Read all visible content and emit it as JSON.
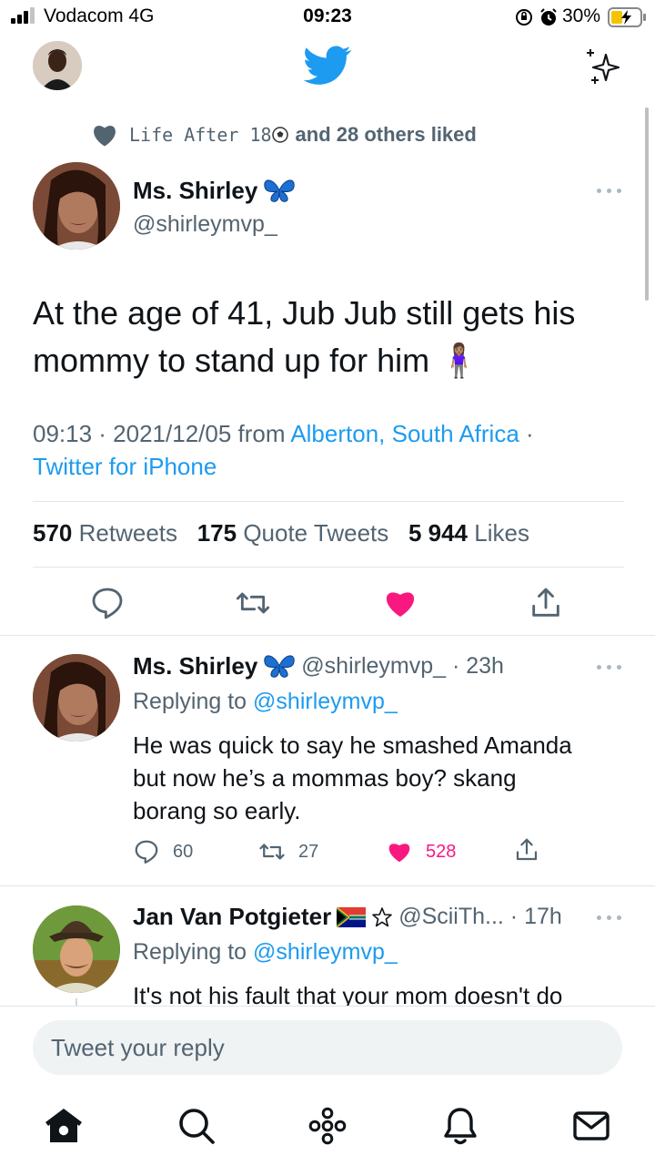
{
  "status_bar": {
    "carrier": "Vodacom  4G",
    "time": "09:23",
    "battery": "30%"
  },
  "header": {
    "logo_icon": "twitter-bird-icon",
    "sparkle_icon": "sparkle-icon",
    "brand_color": "#1d9bf0"
  },
  "social_context": {
    "icon": "heart-icon",
    "liker_name": "Life After 18",
    "rest": "and 28 others liked"
  },
  "tweet": {
    "author_name": "Ms. Shirley",
    "handle": "@shirleymvp_",
    "text": "At the age of 41, Jub Jub still gets his mommy to stand up for him",
    "emoji": "🧍🏽‍♀️",
    "time_date": "09:13 · 2021/12/05 from ",
    "location": "Alberton, South Africa",
    "separator": " ·",
    "client": "Twitter for iPhone",
    "retweets_count": "570",
    "retweets_label": "Retweets",
    "quotes_count": "175",
    "quotes_label": "Quote Tweets",
    "likes_count": "5 944",
    "likes_label": "Likes",
    "like_color": "#f91880"
  },
  "replies": [
    {
      "author_name": "Ms. Shirley",
      "handle_time": "@shirleymvp_ · 23h",
      "replying_prefix": "Replying to ",
      "replying_to": "@shirleymvp_",
      "text_lines": [
        "He was quick to say he smashed Amanda",
        "but now he’s a mommas boy? skang",
        "borang so early."
      ],
      "reply_count": "60",
      "retweet_count": "27",
      "like_count": "528"
    },
    {
      "author_name": "Jan Van Potgieter",
      "handle_time": "@SciiTh... · 17h",
      "replying_prefix": "Replying to ",
      "replying_to": "@shirleymvp_",
      "text_lines": [
        "It's not his fault that your mom doesn't do"
      ]
    }
  ],
  "composer": {
    "placeholder": "Tweet your reply"
  },
  "tab_bar": [
    {
      "name": "home",
      "icon": "home-icon"
    },
    {
      "name": "search",
      "icon": "search-icon"
    },
    {
      "name": "spaces",
      "icon": "spaces-icon"
    },
    {
      "name": "notifications",
      "icon": "bell-icon"
    },
    {
      "name": "messages",
      "icon": "mail-icon"
    }
  ]
}
